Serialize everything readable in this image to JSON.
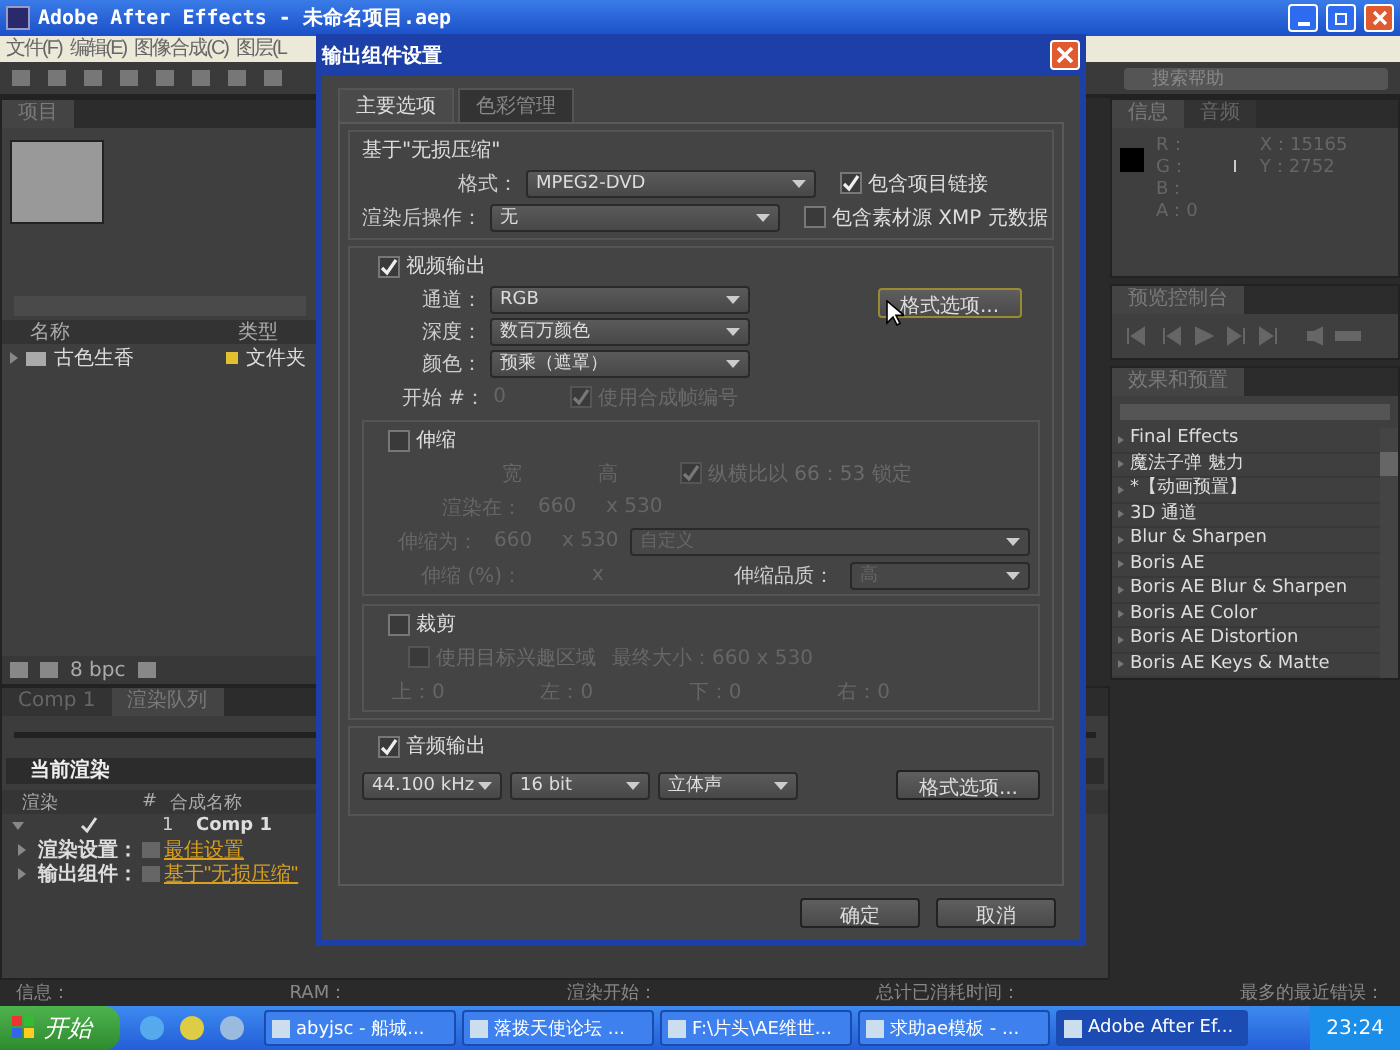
{
  "app": {
    "title": "Adobe After Effects - 未命名项目.aep",
    "menu": [
      "文件(F)",
      "编辑(E)",
      "图像合成(C)",
      "图层(L"
    ],
    "search_placeholder": "搜索帮助"
  },
  "project": {
    "tab": "项目",
    "columns": [
      "名称",
      "类型"
    ],
    "items": [
      {
        "name": "古色生香",
        "type": "文件夹",
        "color": "#e0c030"
      }
    ],
    "bpc": "8 bpc"
  },
  "render_queue": {
    "tabs": [
      {
        "label": "Comp 1",
        "selected": false
      },
      {
        "label": "渲染队列",
        "selected": true
      }
    ],
    "current": "当前渲染",
    "columns": [
      "渲染",
      "#",
      "合成名称"
    ],
    "items": [
      {
        "render": true,
        "index": "1",
        "name": "Comp 1",
        "settings": [
          {
            "label": "渲染设置：",
            "value": "最佳设置"
          },
          {
            "label": "输出组件：",
            "value": "基于\"无损压缩\""
          }
        ]
      }
    ]
  },
  "info": {
    "tabs": [
      {
        "label": "信息",
        "selected": true
      },
      {
        "label": "音频",
        "selected": false
      }
    ],
    "channels": [
      "R：",
      "G：",
      "B：",
      "A：0"
    ],
    "coords": [
      "X：15165",
      "Y：2752"
    ]
  },
  "preview": {
    "tab": "预览控制台"
  },
  "effects": {
    "tab": "效果和预置",
    "items": [
      "Final Effects",
      "魔法子弹 魅力",
      "*【动画预置】",
      "3D 通道",
      "Blur & Sharpen",
      "Boris AE",
      "Boris AE Blur & Sharpen",
      "Boris AE Color",
      "Boris AE Distortion",
      "Boris AE Keys & Matte"
    ]
  },
  "status_bar": [
    "信息：",
    "RAM：",
    "渲染开始：",
    "总计已消耗时间：",
    "最多的最近错误："
  ],
  "taskbar": {
    "start": "开始",
    "tasks": [
      {
        "label": "abyjsc - 船城...",
        "selected": false
      },
      {
        "label": "落拨天使论坛 ...",
        "selected": false
      },
      {
        "label": "F:\\片头\\AE维世...",
        "selected": false
      },
      {
        "label": "求助ae模板 - ...",
        "selected": false
      },
      {
        "label": "Adobe After Ef...",
        "selected": true
      }
    ],
    "clock": "23:24"
  },
  "dialog": {
    "title": "输出组件设置",
    "tabs": [
      {
        "label": "主要选项",
        "selected": true
      },
      {
        "label": "色彩管理",
        "selected": false
      }
    ],
    "based_on": "基于\"无损压缩\"",
    "format": {
      "label": "格式：",
      "value": "MPEG2-DVD"
    },
    "post_render": {
      "label": "渲染后操作：",
      "value": "无"
    },
    "options": [
      {
        "label": "包含项目链接",
        "checked": true
      },
      {
        "label": "包含素材源 XMP 元数据",
        "checked": false
      }
    ],
    "video": {
      "label": "视频输出",
      "checked": true,
      "fields": [
        {
          "label": "通道：",
          "value": "RGB"
        },
        {
          "label": "深度：",
          "value": "数百万颜色"
        },
        {
          "label": "颜色：",
          "value": "预乘（遮罩）"
        }
      ],
      "format_button": "格式选项...",
      "start_label": "开始 #：",
      "start_value": "0",
      "use_comp_frame": {
        "label": "使用合成帧编号",
        "checked": true,
        "disabled": true
      }
    },
    "stretch": {
      "label": "伸缩",
      "checked": false,
      "width_head": "宽",
      "height_head": "高",
      "lock": {
        "label": "纵横比以 66：53 锁定",
        "checked": true
      },
      "render_at": {
        "label": "渲染在：",
        "w": "660",
        "h": "x 530"
      },
      "stretch_to": {
        "label": "伸缩为：",
        "w": "660",
        "h": "x 530",
        "preset": "自定义"
      },
      "percent": {
        "label": "伸缩 (%)：",
        "x": "x"
      },
      "quality": {
        "label": "伸缩品质：",
        "value": "高"
      }
    },
    "crop": {
      "label": "裁剪",
      "checked": false,
      "roi": {
        "label": "使用目标兴趣区域",
        "checked": false
      },
      "final_size": "最终大小：660 x 530",
      "edges": [
        "上：0",
        "左：0",
        "下：0",
        "右：0"
      ]
    },
    "audio": {
      "label": "音频输出",
      "checked": true,
      "rate": "44.100 kHz",
      "depth": "16 bit",
      "channels": "立体声",
      "format_button": "格式选项..."
    },
    "ok": "确定",
    "cancel": "取消"
  }
}
